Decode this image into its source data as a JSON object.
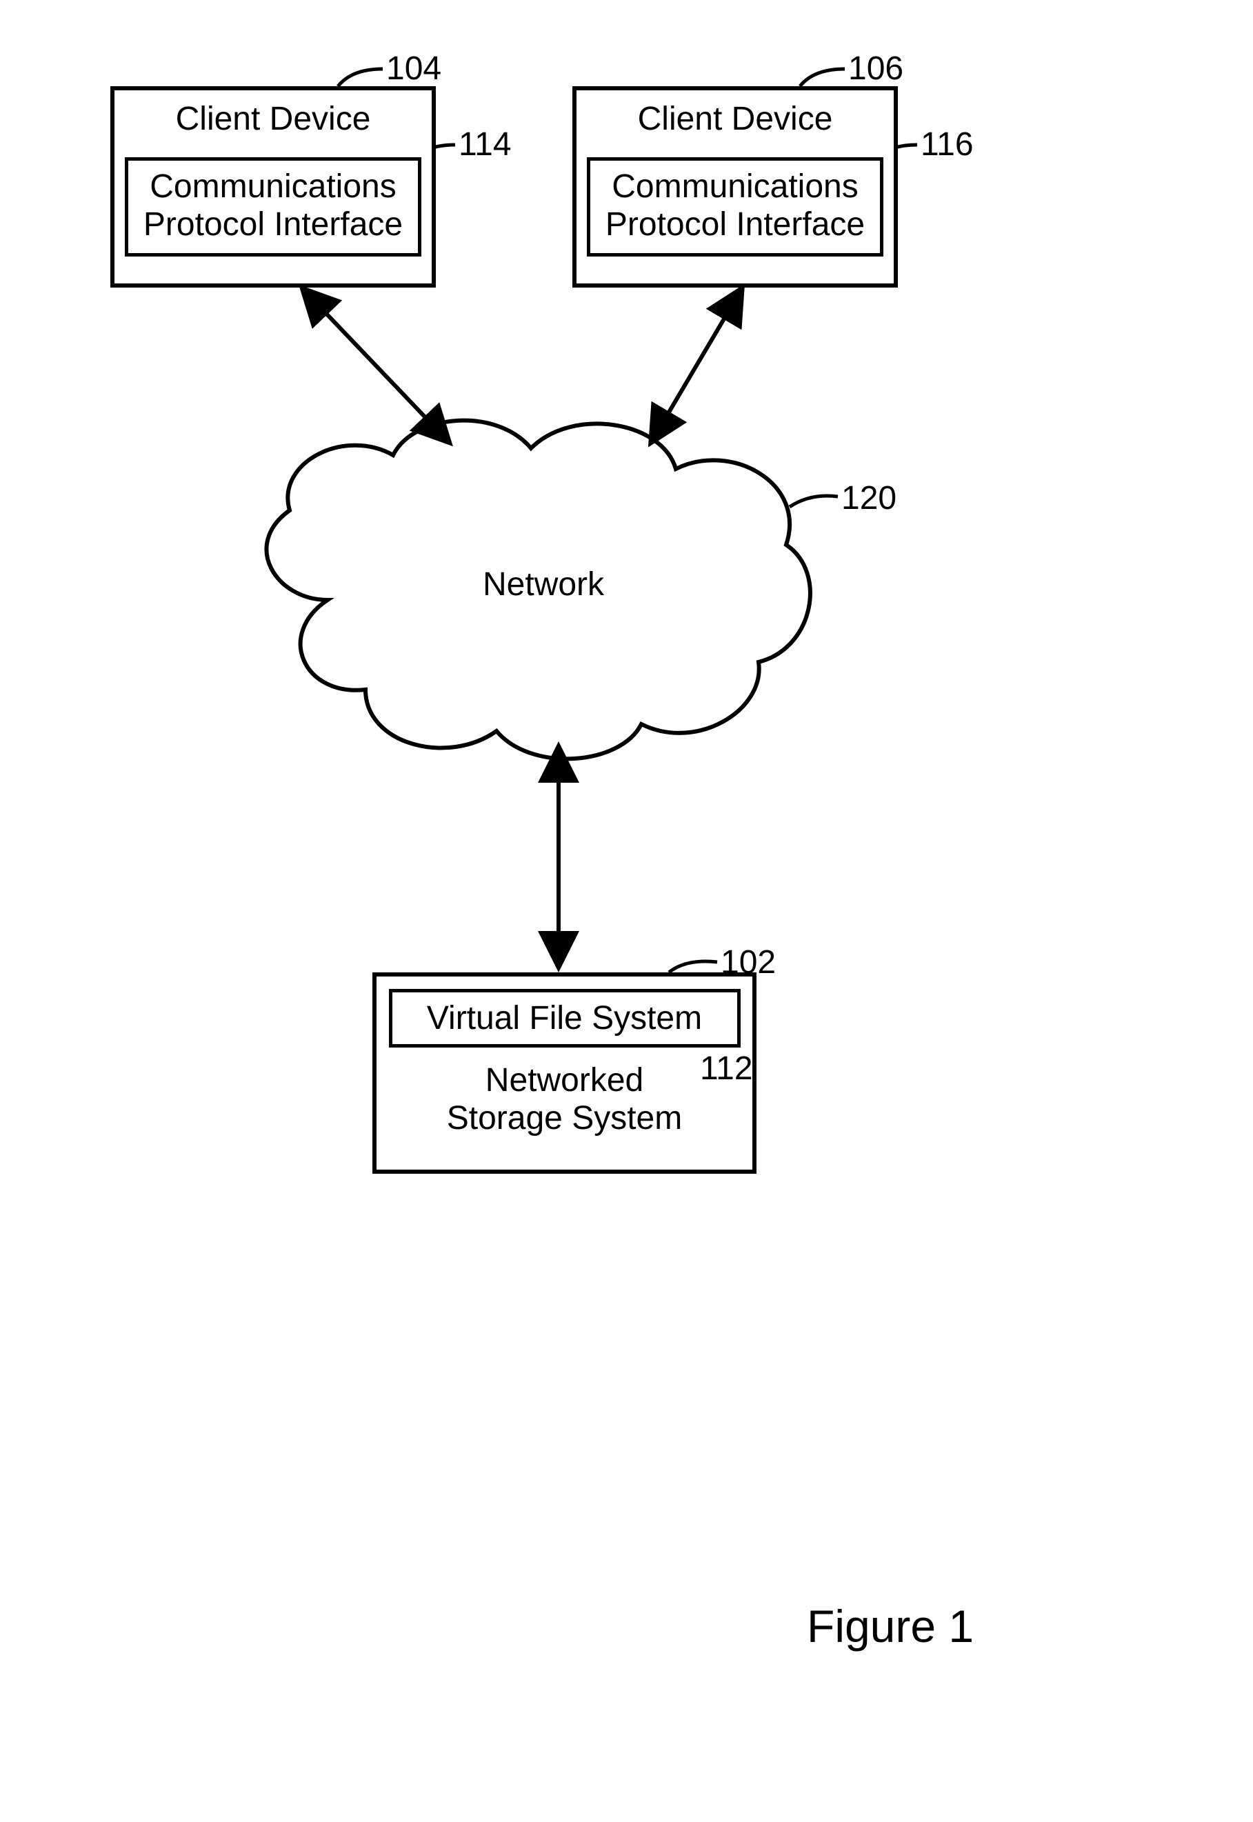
{
  "client1": {
    "ref": "104",
    "title": "Client Device",
    "inner_ref": "114",
    "inner_l1": "Communications",
    "inner_l2": "Protocol Interface"
  },
  "client2": {
    "ref": "106",
    "title": "Client Device",
    "inner_ref": "116",
    "inner_l1": "Communications",
    "inner_l2": "Protocol Interface"
  },
  "network": {
    "ref": "120",
    "label": "Network"
  },
  "storage": {
    "ref": "102",
    "inner_ref": "112",
    "inner": "Virtual File System",
    "l1": "Networked",
    "l2": "Storage System"
  },
  "figure_caption": "Figure 1"
}
